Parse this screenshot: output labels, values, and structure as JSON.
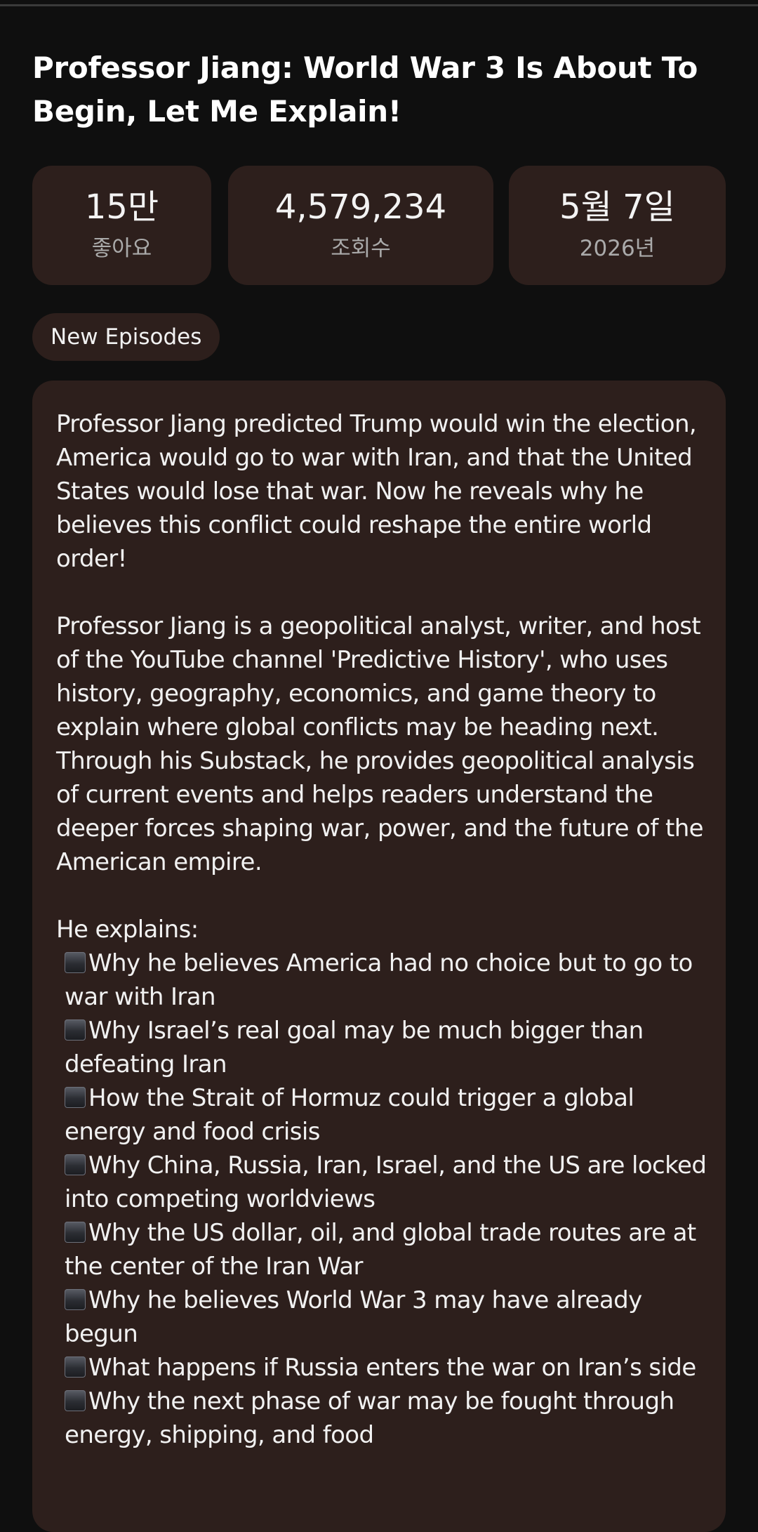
{
  "video": {
    "title": "Professor Jiang: World War 3 Is About To Begin, Let Me Explain!"
  },
  "stats": {
    "likes": {
      "value": "15만",
      "label": "좋아요"
    },
    "views": {
      "value": "4,579,234",
      "label": "조회수"
    },
    "date": {
      "value": "5월 7일",
      "label": "2026년"
    }
  },
  "tag": "New Episodes",
  "description": {
    "paragraph1": "Professor Jiang predicted Trump would win the election, America would go to war with Iran, and that the United States would lose that war. Now he reveals why he believes this conflict could reshape the entire world order!",
    "paragraph2": "Professor Jiang is a geopolitical analyst, writer, and host of the YouTube channel 'Predictive History', who uses history, geography, economics, and game theory to explain where global conflicts may be heading next. Through his Substack, he provides geopolitical analysis of current events and helps readers understand the deeper forces shaping war, power, and the future of the American empire.",
    "intro": "He explains:",
    "bullet_icon": "black-medium-square-icon",
    "bullets": [
      "Why he believes America had no choice but to go to war with Iran",
      "Why Israel’s real goal may be much bigger than defeating Iran",
      "How the Strait of Hormuz could trigger a global energy and food crisis",
      "Why China, Russia, Iran, Israel, and the US are locked into competing worldviews",
      "Why the US dollar, oil, and global trade routes are at the center of the Iran War",
      "Why he believes World War 3 may have already begun",
      "What happens if Russia enters the war on Iran’s side",
      "Why the next phase of war may be fought through energy, shipping, and food"
    ]
  },
  "colors": {
    "background": "#0f0f0f",
    "card": "#2d1f1c",
    "text": "#f1f1f1",
    "muted": "#aaaaaa"
  }
}
